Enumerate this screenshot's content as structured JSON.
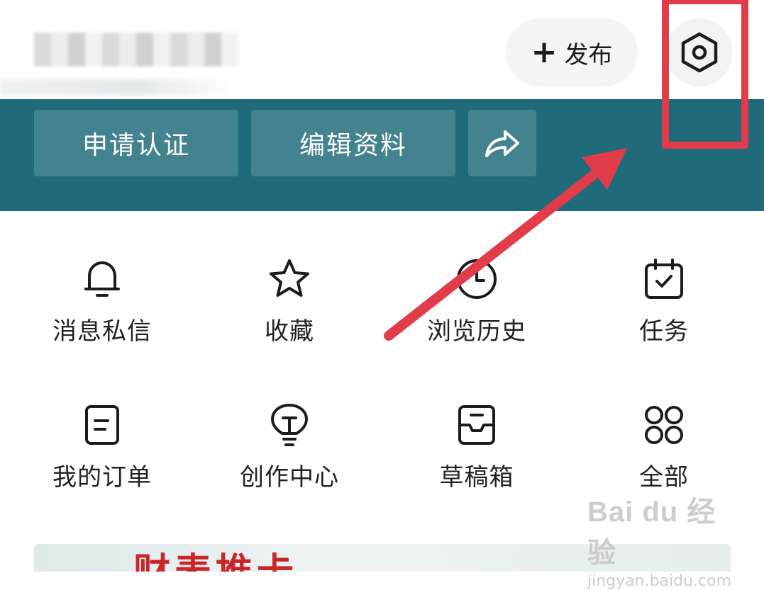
{
  "header": {
    "publish_label": "发布",
    "publish_icon": "plus-icon",
    "settings_icon": "settings-hexagon-icon"
  },
  "banner": {
    "verify_label": "申请认证",
    "edit_label": "编辑资料",
    "share_icon": "share-arrow-icon",
    "color": "#1f6b7a"
  },
  "grid": {
    "items": [
      {
        "label": "消息私信",
        "icon": "bell-icon"
      },
      {
        "label": "收藏",
        "icon": "star-icon"
      },
      {
        "label": "浏览历史",
        "icon": "clock-icon"
      },
      {
        "label": "任务",
        "icon": "calendar-check-icon"
      },
      {
        "label": "我的订单",
        "icon": "order-doc-icon"
      },
      {
        "label": "创作中心",
        "icon": "lightbulb-icon"
      },
      {
        "label": "草稿箱",
        "icon": "inbox-icon"
      },
      {
        "label": "全部",
        "icon": "grid-circles-icon"
      }
    ]
  },
  "bottom_card": {
    "partial_text": "财表推卡"
  },
  "annotation": {
    "color": "#e23b4a"
  },
  "watermark": {
    "main": "Bai du 经验",
    "sub": "jingyan.baidu.com"
  }
}
